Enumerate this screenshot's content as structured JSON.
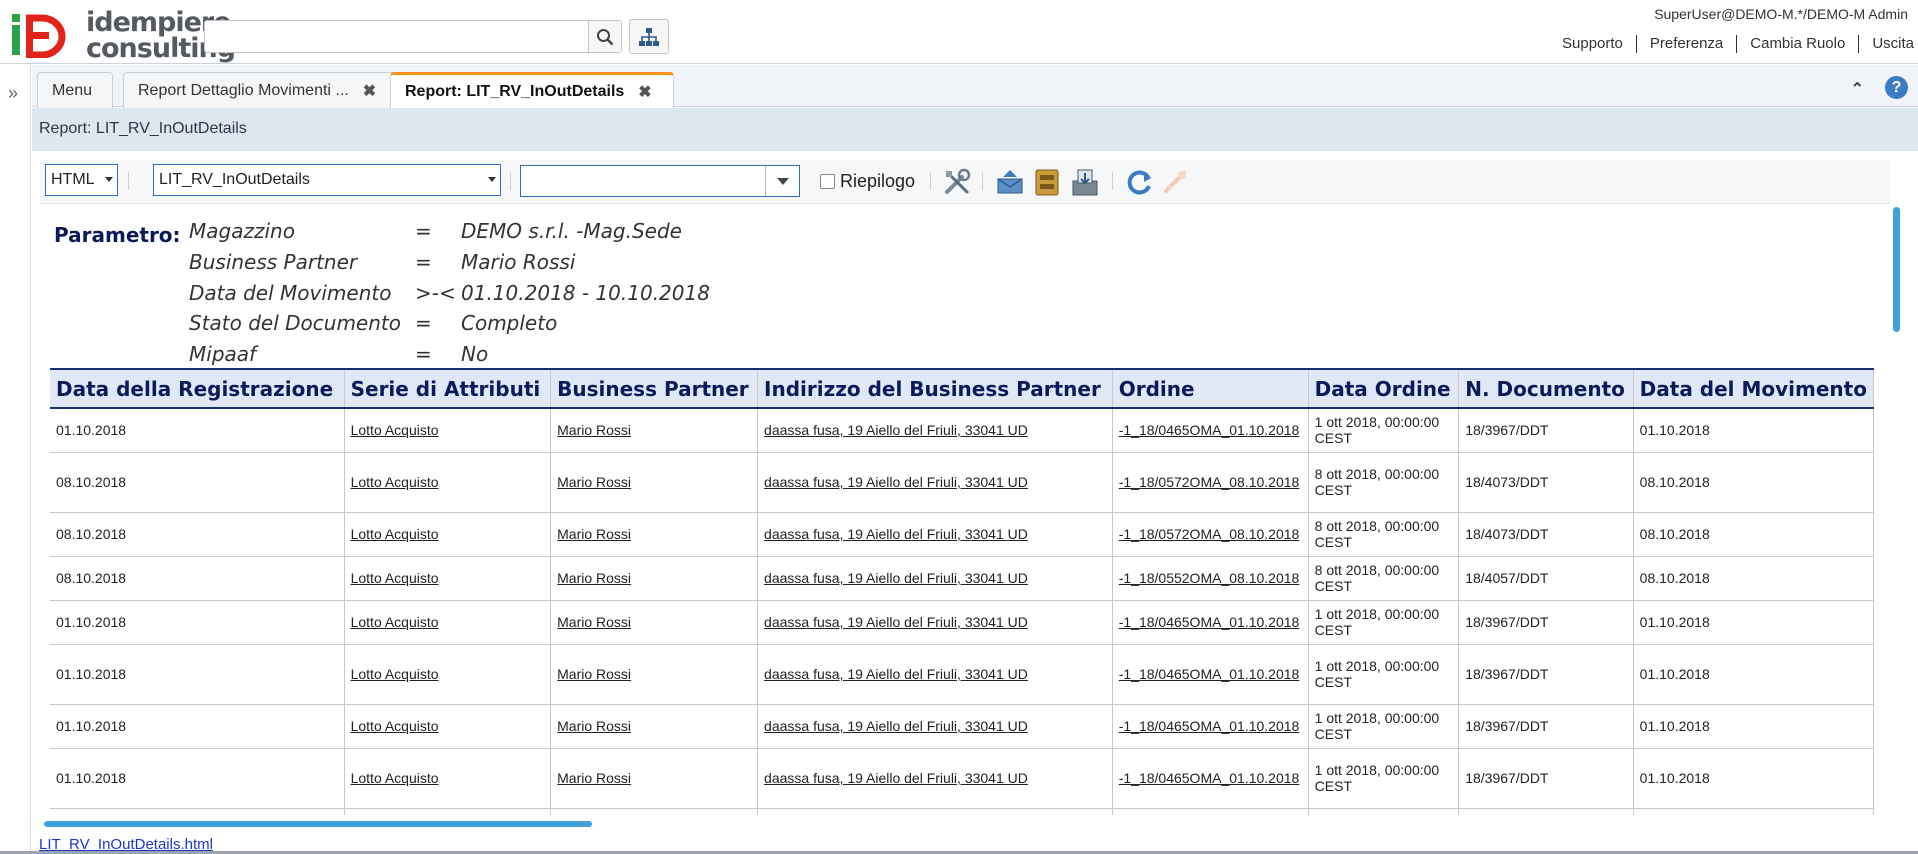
{
  "brand": {
    "word1": "idempiere",
    "word2": "consulting"
  },
  "search": {
    "placeholder": ""
  },
  "user": {
    "label": "SuperUser@DEMO-M.*/DEMO-M Admin",
    "links": [
      "Supporto",
      "Preferenza",
      "Cambia Ruolo",
      "Uscita"
    ]
  },
  "tabs": [
    {
      "label": "Menu",
      "closable": false
    },
    {
      "label": "Report Dettaglio Movimenti ...",
      "closable": true
    },
    {
      "label": "Report: LIT_RV_InOutDetails",
      "closable": true,
      "active": true
    }
  ],
  "tab_close_glyph": "✖",
  "breadcrumb": "Report: LIT_RV_InOutDetails",
  "toolbar": {
    "format_value": "HTML",
    "report_value": "LIT_RV_InOutDetails",
    "combo_value": "",
    "summary_label": "Riepilogo",
    "summary_checked": false
  },
  "params": {
    "label": "Parametro:",
    "rows": [
      {
        "name": "Magazzino",
        "op": "=",
        "value": "DEMO s.r.l. -Mag.Sede"
      },
      {
        "name": "Business Partner",
        "op": "=",
        "value": "Mario Rossi"
      },
      {
        "name": "Data del Movimento",
        "op": ">-<",
        "value": "01.10.2018 - 10.10.2018"
      },
      {
        "name": "Stato del Documento",
        "op": "=",
        "value": "Completo"
      },
      {
        "name": "Mipaaf",
        "op": "=",
        "value": "No"
      }
    ]
  },
  "table": {
    "columns": [
      "Data della Registrazione",
      "Serie di Attributi",
      "Business Partner",
      "Indirizzo del Business Partner",
      "Ordine",
      "Data Ordine",
      "N. Documento",
      "Data del Movimento"
    ],
    "rows": [
      [
        "01.10.2018",
        "Lotto Acquisto",
        "Mario Rossi",
        "daassa fusa, 19 Aiello del Friuli, 33041 UD",
        "-1_18/0465OMA_01.10.2018",
        "1 ott 2018, 00:00:00 CEST",
        "18/3967/DDT",
        "01.10.2018"
      ],
      [
        "08.10.2018",
        "Lotto Acquisto",
        "Mario Rossi",
        "daassa fusa, 19 Aiello del Friuli, 33041 UD",
        "-1_18/0572OMA_08.10.2018",
        "8 ott 2018, 00:00:00 CEST",
        "18/4073/DDT",
        "08.10.2018"
      ],
      [
        "08.10.2018",
        "Lotto Acquisto",
        "Mario Rossi",
        "daassa fusa, 19 Aiello del Friuli, 33041 UD",
        "-1_18/0572OMA_08.10.2018",
        "8 ott 2018, 00:00:00 CEST",
        "18/4073/DDT",
        "08.10.2018"
      ],
      [
        "08.10.2018",
        "Lotto Acquisto",
        "Mario Rossi",
        "daassa fusa, 19 Aiello del Friuli, 33041 UD",
        "-1_18/0552OMA_08.10.2018",
        "8 ott 2018, 00:00:00 CEST",
        "18/4057/DDT",
        "08.10.2018"
      ],
      [
        "01.10.2018",
        "Lotto Acquisto",
        "Mario Rossi",
        "daassa fusa, 19 Aiello del Friuli, 33041 UD",
        "-1_18/0465OMA_01.10.2018",
        "1 ott 2018, 00:00:00 CEST",
        "18/3967/DDT",
        "01.10.2018"
      ],
      [
        "01.10.2018",
        "Lotto Acquisto",
        "Mario Rossi",
        "daassa fusa, 19 Aiello del Friuli, 33041 UD",
        "-1_18/0465OMA_01.10.2018",
        "1 ott 2018, 00:00:00 CEST",
        "18/3967/DDT",
        "01.10.2018"
      ],
      [
        "01.10.2018",
        "Lotto Acquisto",
        "Mario Rossi",
        "daassa fusa, 19 Aiello del Friuli, 33041 UD",
        "-1_18/0465OMA_01.10.2018",
        "1 ott 2018, 00:00:00 CEST",
        "18/3967/DDT",
        "01.10.2018"
      ],
      [
        "01.10.2018",
        "Lotto Acquisto",
        "Mario Rossi",
        "daassa fusa, 19 Aiello del Friuli, 33041 UD",
        "-1_18/0465OMA_01.10.2018",
        "1 ott 2018, 00:00:00 CEST",
        "18/3967/DDT",
        "01.10.2018"
      ],
      [
        "",
        "",
        "",
        "",
        "",
        "",
        "",
        ""
      ]
    ]
  },
  "file_link": "LIT_RV_InOutDetails.html",
  "colors": {
    "accent": "#f7931e",
    "brand_green": "#2aa24a",
    "brand_red": "#e2231a",
    "link_blue": "#1a37c8",
    "header_blue": "#0b1a5a"
  }
}
